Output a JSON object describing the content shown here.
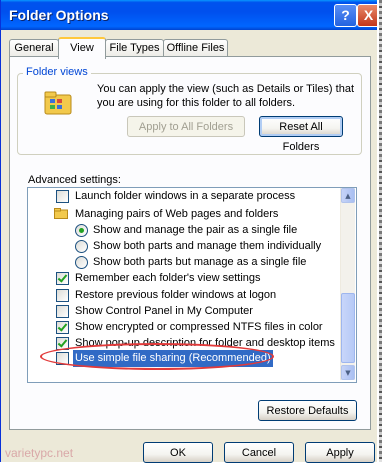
{
  "window": {
    "title": "Folder Options",
    "help_button": "?",
    "close_button": "X"
  },
  "tabs": [
    "General",
    "View",
    "File Types",
    "Offline Files"
  ],
  "folder_views": {
    "legend": "Folder views",
    "description": "You can apply the view (such as Details or Tiles) that you are using for this folder to all folders.",
    "apply_button": "Apply to All Folders",
    "reset_button": "Reset All Folders"
  },
  "advanced": {
    "label": "Advanced settings:",
    "items": [
      {
        "kind": "checkbox",
        "checked": false,
        "label": "Launch folder windows in a separate process"
      },
      {
        "kind": "folder",
        "label": "Managing pairs of Web pages and folders"
      },
      {
        "kind": "radio",
        "checked": true,
        "label": "Show and manage the pair as a single file"
      },
      {
        "kind": "radio",
        "checked": false,
        "label": "Show both parts and manage them individually"
      },
      {
        "kind": "radio",
        "checked": false,
        "label": "Show both parts but manage as a single file"
      },
      {
        "kind": "checkbox",
        "checked": true,
        "label": "Remember each folder's view settings"
      },
      {
        "kind": "checkbox",
        "checked": false,
        "label": "Restore previous folder windows at logon"
      },
      {
        "kind": "checkbox",
        "checked": false,
        "label": "Show Control Panel in My Computer"
      },
      {
        "kind": "checkbox",
        "checked": true,
        "label": "Show encrypted or compressed NTFS files in color"
      },
      {
        "kind": "checkbox",
        "checked": true,
        "label": "Show pop-up description for folder and desktop items"
      },
      {
        "kind": "checkbox",
        "checked": false,
        "label": "Use simple file sharing (Recommended)",
        "selected": true
      }
    ],
    "restore_defaults": "Restore Defaults"
  },
  "footer": {
    "ok": "OK",
    "cancel": "Cancel",
    "apply": "Apply"
  },
  "watermark": "varietypc.net",
  "colors": {
    "title_bar": "#0053ee",
    "selection": "#316ac5",
    "annotation": "#e23a3a",
    "check": "#21a121"
  }
}
